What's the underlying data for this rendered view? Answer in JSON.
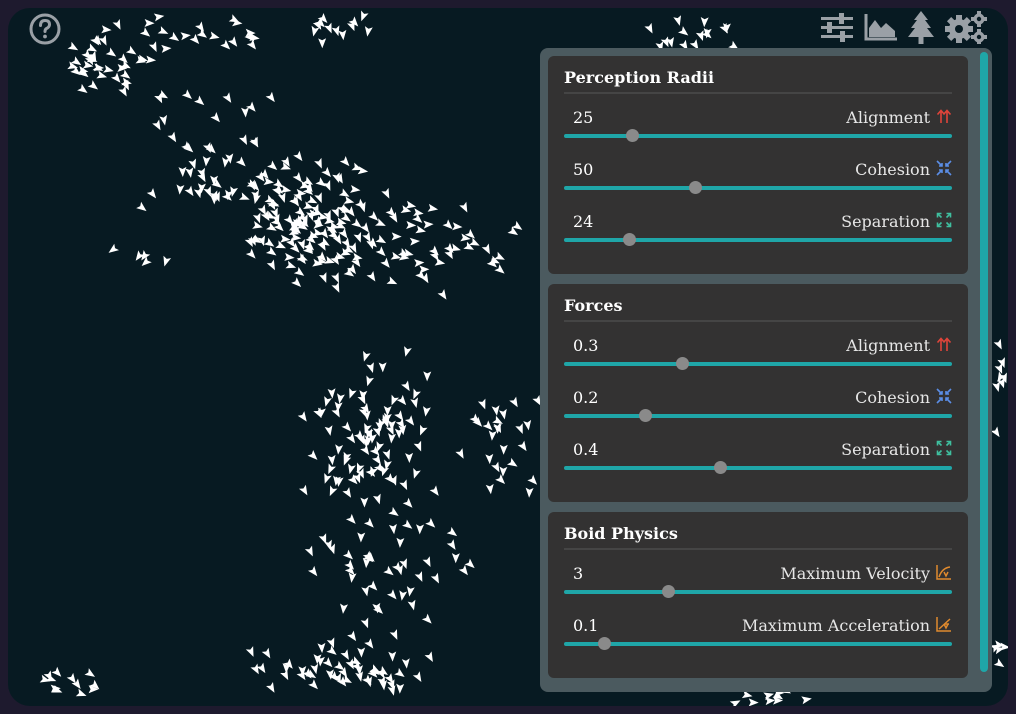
{
  "colors": {
    "canvas": "#071a22",
    "panel": "#4b5a5f",
    "section": "#333232",
    "slider_track": "#1fa6a8",
    "slider_thumb": "#8a8a8a",
    "alignment_icon": "#e0443a",
    "cohesion_icon": "#5b8ee6",
    "separation_icon": "#3fbf9f",
    "physics_icon": "#e08a2e"
  },
  "toolbar": {
    "icons": [
      "help-icon",
      "sliders-icon",
      "area-chart-icon",
      "tree-icon",
      "gears-icon"
    ]
  },
  "sections": [
    {
      "title": "Perception Radii",
      "controls": [
        {
          "label": "Alignment",
          "value": "25",
          "fraction": 0.175,
          "icon": "arrows-up-icon"
        },
        {
          "label": "Cohesion",
          "value": "50",
          "fraction": 0.337,
          "icon": "converge-icon"
        },
        {
          "label": "Separation",
          "value": "24",
          "fraction": 0.168,
          "icon": "expand-icon"
        }
      ]
    },
    {
      "title": "Forces",
      "controls": [
        {
          "label": "Alignment",
          "value": "0.3",
          "fraction": 0.304,
          "icon": "arrows-up-icon"
        },
        {
          "label": "Cohesion",
          "value": "0.2",
          "fraction": 0.209,
          "icon": "converge-icon"
        },
        {
          "label": "Separation",
          "value": "0.4",
          "fraction": 0.403,
          "icon": "expand-icon"
        }
      ]
    },
    {
      "title": "Boid Physics",
      "controls": [
        {
          "label": "Maximum Velocity",
          "value": "3",
          "fraction": 0.268,
          "icon": "velocity-graph-icon"
        },
        {
          "label": "Maximum Acceleration",
          "value": "0.1",
          "fraction": 0.103,
          "icon": "acceleration-graph-icon"
        }
      ]
    }
  ]
}
